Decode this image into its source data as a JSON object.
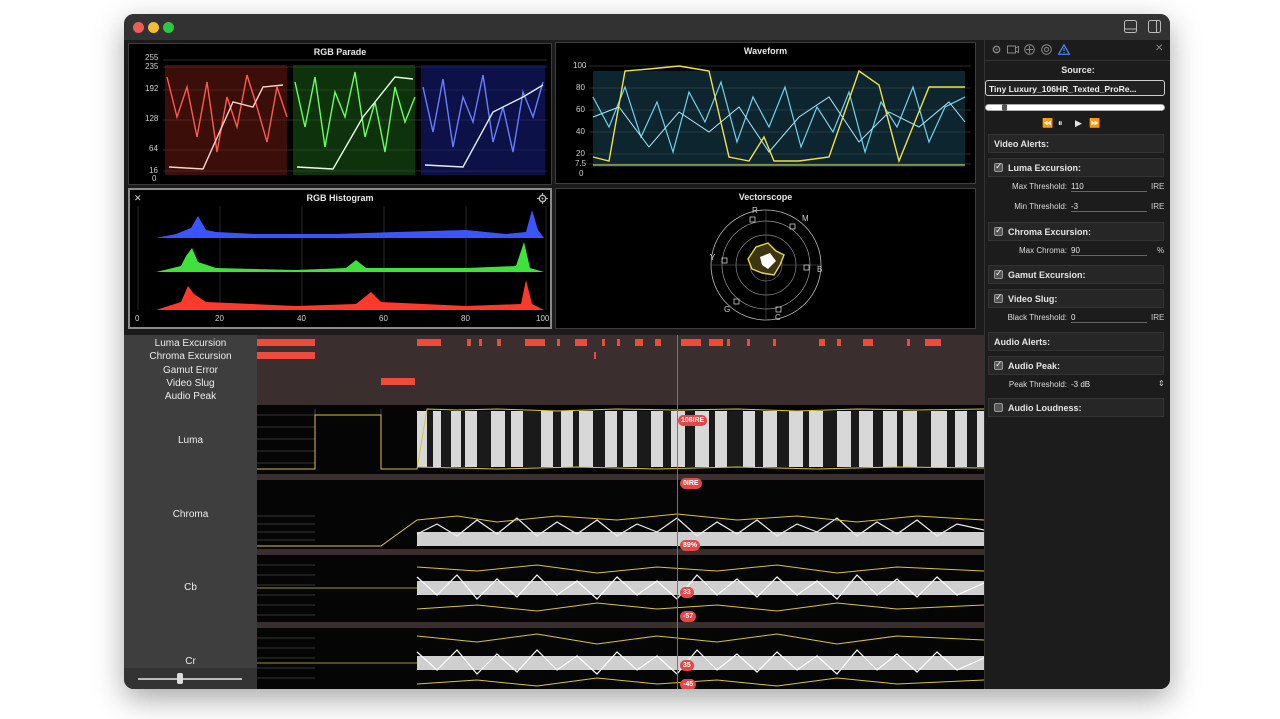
{
  "window": {
    "traffic_lights": [
      "#ee5d55",
      "#f5bd35",
      "#2bc840"
    ]
  },
  "scopes": {
    "rgb_parade": {
      "title": "RGB Parade",
      "axis_labels": [
        "255",
        "235",
        "192",
        "128",
        "64",
        "16",
        "0"
      ]
    },
    "waveform": {
      "title": "Waveform",
      "axis_labels": [
        "100",
        "80",
        "60",
        "40",
        "20",
        "7.5",
        "0"
      ]
    },
    "histogram": {
      "title": "RGB Histogram",
      "x_labels": [
        "0",
        "20",
        "40",
        "60",
        "80",
        "100"
      ],
      "close": "✕",
      "settings": "gear-icon"
    },
    "vectorscope": {
      "title": "Vectorscope",
      "markers": [
        "R",
        "M",
        "B",
        "C",
        "G",
        "Y"
      ]
    }
  },
  "sidebar": {
    "toolbar_icons": [
      "gear-icon",
      "camera-icon",
      "scopes-icon",
      "target-icon",
      "alert-triangle-icon"
    ],
    "close": "✕",
    "source_label": "Source:",
    "source_value": "Tiny Luxury_106HR_Texted_ProRe...",
    "transport": [
      "⏪",
      "⏸",
      "▶",
      "⏩"
    ],
    "video_alerts_title": "Video Alerts:",
    "luma_excursion": {
      "label": "Luma Excursion:",
      "checked": true,
      "max_label": "Max Threshold:",
      "max_value": "110",
      "min_label": "Min Threshold:",
      "min_value": "-3",
      "unit": "IRE"
    },
    "chroma_excursion": {
      "label": "Chroma Excursion:",
      "checked": true,
      "max_label": "Max Chroma:",
      "max_value": "90",
      "unit": "%"
    },
    "gamut_excursion": {
      "label": "Gamut Excursion:",
      "checked": true
    },
    "video_slug": {
      "label": "Video Slug:",
      "checked": true,
      "black_label": "Black Threshold:",
      "black_value": "0",
      "unit": "IRE"
    },
    "audio_alerts_title": "Audio Alerts:",
    "audio_peak": {
      "label": "Audio Peak:",
      "checked": true,
      "peak_label": "Peak Threshold:",
      "peak_value": "-3 dB",
      "stepper": "⇕"
    },
    "audio_loudness": {
      "label": "Audio Loudness:",
      "checked": false
    }
  },
  "timeline": {
    "alert_rows": [
      "Luma Excursion",
      "Chroma Excursion",
      "Gamut Error",
      "Video Slug",
      "Audio Peak"
    ],
    "tracks": [
      "Luma",
      "Chroma",
      "Cb",
      "Cr"
    ],
    "badges": {
      "luma_top": "106IRE",
      "luma_bottom": "0IRE",
      "chroma": "89%",
      "cb_top": "33",
      "cb_bottom": "-57",
      "cr_top": "35",
      "cr_bottom": "-45"
    },
    "zoom_slider_value": 0.4
  }
}
